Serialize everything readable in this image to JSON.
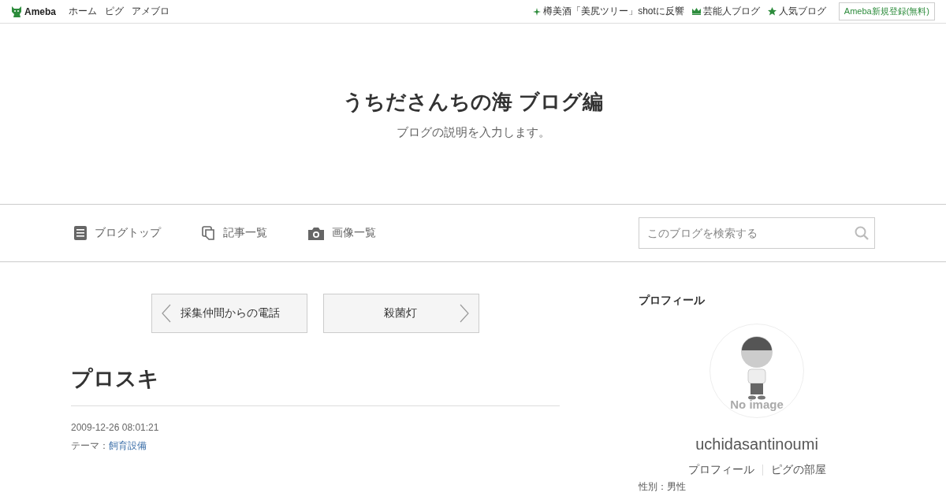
{
  "header": {
    "logo": "Ameba",
    "nav": [
      "ホーム",
      "ピグ",
      "アメブロ"
    ],
    "links": [
      {
        "kind": "spark",
        "label": "樽美酒「美尻ツリー」shotに反響"
      },
      {
        "kind": "crown",
        "label": "芸能人ブログ"
      },
      {
        "kind": "star",
        "label": "人気ブログ"
      }
    ],
    "register": "Ameba新規登録(無料)"
  },
  "blog": {
    "title": "うちださんちの海 ブログ編",
    "description": "ブログの説明を入力します。"
  },
  "menu": [
    {
      "kind": "doc",
      "label": "ブログトップ"
    },
    {
      "kind": "copy",
      "label": "記事一覧"
    },
    {
      "kind": "camera",
      "label": "画像一覧"
    }
  ],
  "search": {
    "placeholder": "このブログを検索する"
  },
  "pager": {
    "prev": "採集仲間からの電話",
    "next": "殺菌灯"
  },
  "article": {
    "title": "プロスキ",
    "date": "2009-12-26 08:01:21",
    "theme_label": "テーマ：",
    "theme": "飼育設備"
  },
  "profile": {
    "heading": "プロフィール",
    "no_image": "No image",
    "name": "uchidasantinoumi",
    "links": [
      "プロフィール",
      "ピグの部屋"
    ],
    "detail": "性別：男性"
  }
}
